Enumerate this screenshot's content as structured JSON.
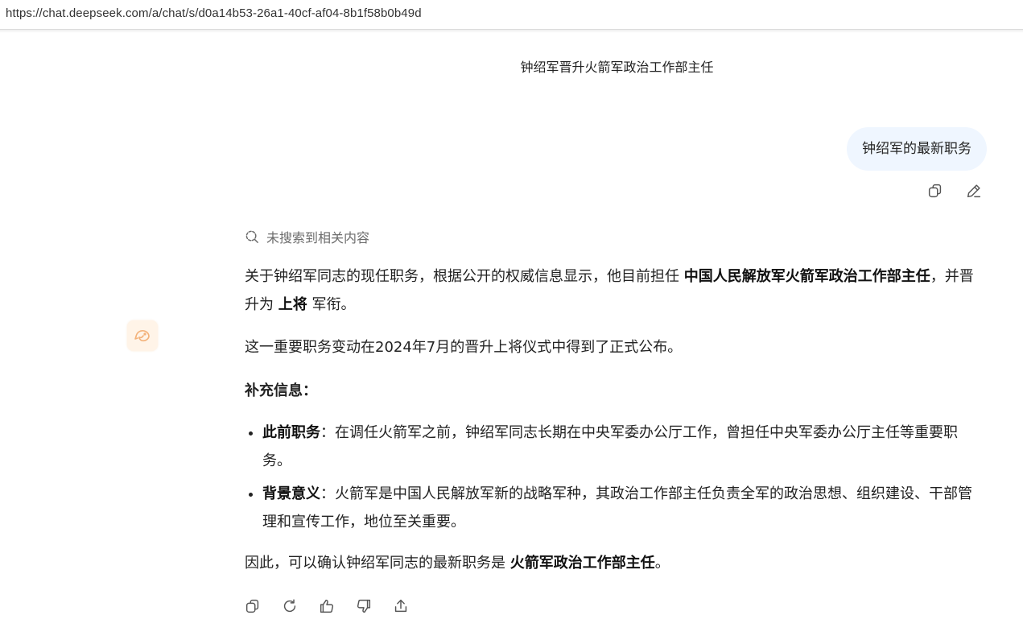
{
  "browser": {
    "url": "https://chat.deepseek.com/a/chat/s/d0a14b53-26a1-40cf-af04-8b1f58b0b49d"
  },
  "chat": {
    "title": "钟绍军晋升火箭军政治工作部主任"
  },
  "user_message": {
    "text": "钟绍军的最新职务",
    "actions": {
      "copy_icon": "copy-icon",
      "edit_icon": "edit-icon"
    }
  },
  "assistant": {
    "avatar_icon": "deepseek-whale-icon",
    "search_status": "未搜索到相关内容",
    "para1": {
      "t1": "关于钟绍军同志的现任职务，根据公开的权威信息显示，他目前担任 ",
      "b1": "中国人民解放军火箭军政治工作部主任",
      "t2": "，并晋升为 ",
      "b2": "上将",
      "t3": " 军衔。"
    },
    "para2": "这一重要职务变动在2024年7月的晋升上将仪式中得到了正式公布。",
    "supplement_heading": "补充信息：",
    "bullets": [
      {
        "label": "此前职务",
        "text": "：在调任火箭军之前，钟绍军同志长期在中央军委办公厅工作，曾担任中央军委办公厅主任等重要职务。"
      },
      {
        "label": "背景意义",
        "text": "：火箭军是中国人民解放军新的战略军种，其政治工作部主任负责全军的政治思想、组织建设、干部管理和宣传工作，地位至关重要。"
      }
    ],
    "conclusion": {
      "t1": "因此，可以确认钟绍军同志的最新职务是 ",
      "b1": "火箭军政治工作部主任",
      "t2": "。"
    },
    "actions": [
      "copy-icon",
      "regenerate-icon",
      "thumbs-up-icon",
      "thumbs-down-icon",
      "share-icon"
    ]
  },
  "colors": {
    "user_bubble": "#eff6ff",
    "avatar_bg": "#fff4e8",
    "muted_text": "#6b6b6b",
    "icon_stroke": "#555555"
  }
}
